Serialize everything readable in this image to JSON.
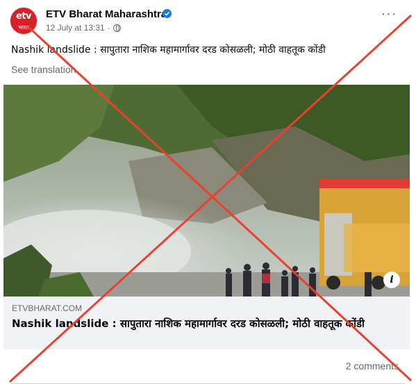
{
  "post": {
    "page_name": "ETV Bharat Maharashtra",
    "avatar_logo": "etv",
    "avatar_sub": "भारत",
    "date": "12 July at 13:31",
    "meta_separator": "·",
    "caption": "Nashik landslide : सापुतारा नाशिक महामार्गावर दरड कोसळली; मोठी वाहतूक कोंडी",
    "see_translation": "See translation",
    "more_label": "···"
  },
  "link_preview": {
    "domain": "ETVBHARAT.COM",
    "title": "Nashik landslide : सापुतारा नाशिक महामार्गावर दरड कोसळली; मोठी वाहतूक कोंडी",
    "info_label": "i"
  },
  "footer": {
    "comments": "2 comments"
  },
  "colors": {
    "cross": "#e8412e",
    "brand": "#d62128",
    "verified": "#1877f2"
  },
  "icons": [
    "verified-badge-icon",
    "globe-icon",
    "more-options-icon",
    "info-icon"
  ]
}
